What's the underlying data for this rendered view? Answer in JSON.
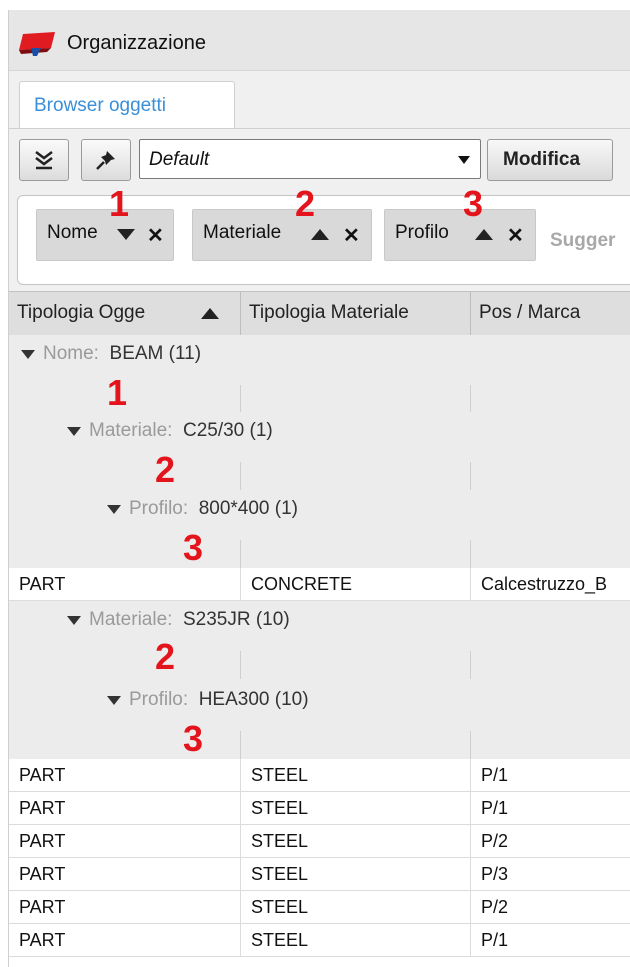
{
  "window": {
    "title": "Organizzazione"
  },
  "tabs": [
    {
      "label": "Browser oggetti",
      "active": true
    }
  ],
  "toolbar": {
    "collapse_icon": "double-chevron-down-icon",
    "pin_icon": "pin-icon",
    "dropdown_value": "Default",
    "modify_label": "Modifica"
  },
  "grouping": {
    "chips": [
      {
        "label": "Nome",
        "sort": "desc",
        "marker": "1"
      },
      {
        "label": "Materiale",
        "sort": "asc",
        "marker": "2"
      },
      {
        "label": "Profilo",
        "sort": "asc",
        "marker": "3"
      }
    ],
    "suggest_text": "Sugger"
  },
  "table": {
    "columns": [
      "Tipologia Ogge",
      "Tipologia Materiale",
      "Pos / Marca"
    ],
    "groups": [
      {
        "key": "Nome:",
        "value": "BEAM (11)",
        "marker": "1"
      },
      {
        "key": "Materiale:",
        "value": "C25/30 (1)",
        "marker": "2"
      },
      {
        "key": "Profilo:",
        "value": "800*400 (1)",
        "marker": "3"
      },
      {
        "key": "Materiale:",
        "value": "S235JR (10)",
        "marker": "2"
      },
      {
        "key": "Profilo:",
        "value": "HEA300 (10)",
        "marker": "3"
      }
    ],
    "rows": [
      [
        "PART",
        "CONCRETE",
        "Calcestruzzo_B"
      ],
      [
        "PART",
        "STEEL",
        "P/1"
      ],
      [
        "PART",
        "STEEL",
        "P/1"
      ],
      [
        "PART",
        "STEEL",
        "P/2"
      ],
      [
        "PART",
        "STEEL",
        "P/3"
      ],
      [
        "PART",
        "STEEL",
        "P/2"
      ],
      [
        "PART",
        "STEEL",
        "P/1"
      ]
    ]
  }
}
